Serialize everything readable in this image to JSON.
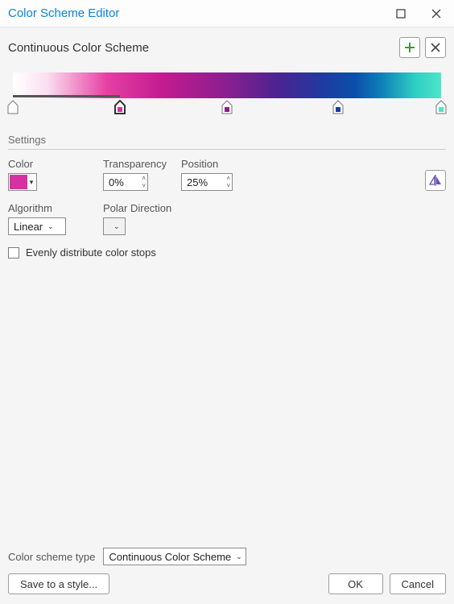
{
  "window": {
    "title": "Color Scheme Editor"
  },
  "header": {
    "title": "Continuous Color Scheme"
  },
  "gradient": {
    "selected_index": 1,
    "stops": [
      {
        "position": 0,
        "color": "#ffffff",
        "selected": false
      },
      {
        "position": 25,
        "color": "#d631a0",
        "selected": true
      },
      {
        "position": 50,
        "color": "#8f1b88",
        "selected": false
      },
      {
        "position": 76,
        "color": "#153f9e",
        "selected": false
      },
      {
        "position": 100,
        "color": "#4de3c8",
        "selected": false
      }
    ]
  },
  "settings": {
    "section_label": "Settings",
    "labels": {
      "color": "Color",
      "transparency": "Transparency",
      "position": "Position",
      "algorithm": "Algorithm",
      "polar_direction": "Polar Direction",
      "evenly_distribute": "Evenly distribute color stops"
    },
    "color": "#d631a0",
    "transparency": "0%",
    "position": "25%",
    "algorithm": "Linear",
    "polar_direction": "",
    "evenly_distribute": false
  },
  "footer": {
    "scheme_type_label": "Color scheme type",
    "scheme_type_value": "Continuous Color Scheme",
    "save_label": "Save to a style...",
    "ok_label": "OK",
    "cancel_label": "Cancel"
  }
}
